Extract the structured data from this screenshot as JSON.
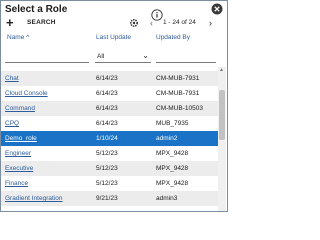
{
  "dialog": {
    "title": "Select a Role",
    "accent": "#1a73c6"
  },
  "toolbar": {
    "add_label": "+",
    "search_label": "SEARCH",
    "count_text": "1 - 24 of 24"
  },
  "columns": {
    "name": "Name",
    "last_update": "Last Update",
    "updated_by": "Updated By",
    "name_sort": "^"
  },
  "filters": {
    "name": "",
    "last_update": "All",
    "updated_by": ""
  },
  "rows": [
    {
      "name": "Chat",
      "date": "6/14/23",
      "user": "CM-MUB-7931"
    },
    {
      "name": "Cloud Console",
      "date": "6/14/23",
      "user": "CM-MUB-7931"
    },
    {
      "name": "Command",
      "date": "6/14/23",
      "user": "CM-MUB-10503"
    },
    {
      "name": "CPQ",
      "date": "6/14/23",
      "user": "MUB_7935"
    },
    {
      "name": "Demo_role",
      "date": "1/10/24",
      "user": "admin2",
      "selected": true
    },
    {
      "name": "Engineer",
      "date": "5/12/23",
      "user": "MPX_9428"
    },
    {
      "name": "Executive",
      "date": "5/12/23",
      "user": "MPX_9428"
    },
    {
      "name": "Finance",
      "date": "5/12/23",
      "user": "MPX_9428"
    },
    {
      "name": "Gradient Integration",
      "date": "9/21/23",
      "user": "admin3"
    }
  ]
}
